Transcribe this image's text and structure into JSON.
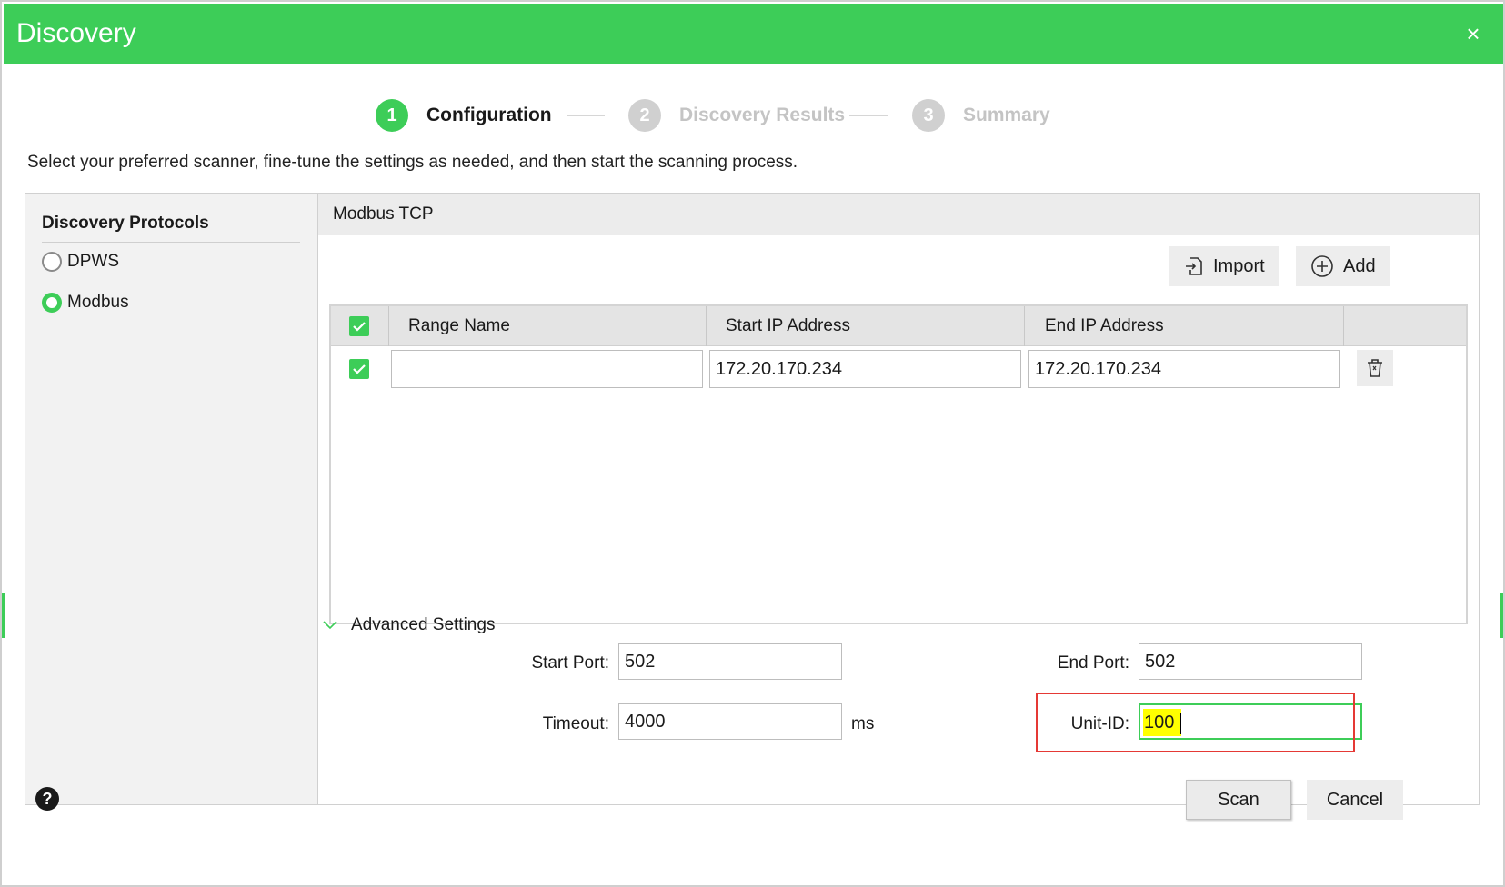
{
  "window": {
    "title": "Discovery",
    "close_glyph": "×"
  },
  "stepper": {
    "steps": [
      {
        "number": "1",
        "label": "Configuration",
        "state": "active"
      },
      {
        "number": "2",
        "label": "Discovery Results",
        "state": "inactive"
      },
      {
        "number": "3",
        "label": "Summary",
        "state": "inactive"
      }
    ]
  },
  "intro_text": "Select your preferred scanner, fine-tune the settings as needed, and then start the scanning process.",
  "protocols": {
    "title": "Discovery Protocols",
    "options": [
      {
        "label": "DPWS",
        "selected": false
      },
      {
        "label": "Modbus",
        "selected": true
      }
    ]
  },
  "modbus": {
    "header": "Modbus TCP",
    "import_label": "Import",
    "add_label": "Add",
    "table": {
      "columns": [
        "Range Name",
        "Start IP Address",
        "End IP Address"
      ],
      "header_checked": true,
      "rows": [
        {
          "checked": true,
          "range_name": "",
          "start_ip": "172.20.170.234",
          "end_ip": "172.20.170.234"
        }
      ]
    },
    "advanced": {
      "label": "Advanced Settings",
      "start_port_label": "Start Port:",
      "start_port": "502",
      "end_port_label": "End Port:",
      "end_port": "502",
      "timeout_label": "Timeout:",
      "timeout": "4000",
      "timeout_unit": "ms",
      "unit_id_label": "Unit-ID:",
      "unit_id": "100"
    }
  },
  "footer": {
    "help_glyph": "?",
    "scan_label": "Scan",
    "cancel_label": "Cancel"
  },
  "colors": {
    "accent": "#3dcd58",
    "highlight": "#ffff00",
    "annotation_box": "#e53935"
  }
}
